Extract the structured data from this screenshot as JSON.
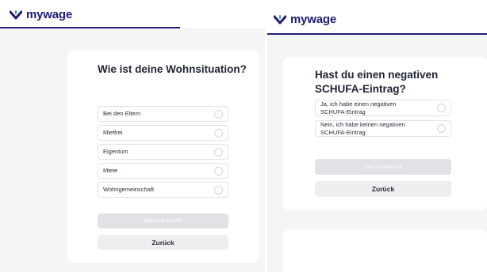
{
  "brand": {
    "name": "mywage",
    "color": "#1e1b72",
    "logo_icon": "checkmark-v-icon"
  },
  "left_step": {
    "question": "Wie ist deine Wohnsituation?",
    "options": [
      {
        "label": "Bei den Eltern"
      },
      {
        "label": "Mietfrei"
      },
      {
        "label": "Eigentum"
      },
      {
        "label": "Miete"
      },
      {
        "label": "Wohngemeinschaft"
      }
    ],
    "primary_button": "Nächster Schritt",
    "back_button": "Zurück"
  },
  "right_step": {
    "question": "Hast du einen negativen SCHUFA-Eintrag?",
    "options": [
      {
        "label": "Ja, ich habe einen negativen SCHUFA-Eintrag"
      },
      {
        "label": "Nein, ich habe keinen negativen SCHUFA-Eintrag"
      }
    ],
    "primary_button": "Zum Dashboard",
    "back_button": "Zurück"
  },
  "colors": {
    "page_background": "#f5f5f6",
    "disabled_button": "#e2e2e6",
    "secondary_button": "#eeeef1"
  }
}
